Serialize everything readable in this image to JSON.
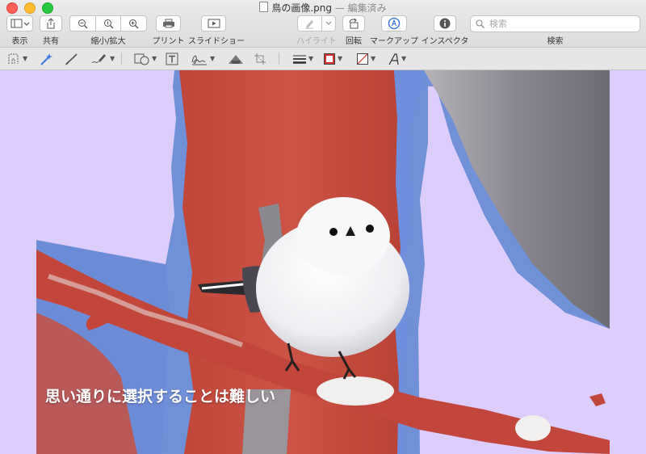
{
  "window": {
    "title": "鳥の画像.png",
    "title_separator": "—",
    "status": "編集済み"
  },
  "toolbar": {
    "view_label": "表示",
    "share_label": "共有",
    "zoom_label": "縮小/拡大",
    "print_label": "プリント",
    "slideshow_label": "スライドショー",
    "highlight_label": "ハイライト",
    "rotate_label": "回転",
    "markup_label": "マークアップ",
    "inspector_label": "インスペクタ",
    "search_label": "検索",
    "search_placeholder": "検索"
  },
  "image": {
    "caption": "思い通りに選択することは難しい"
  },
  "colors": {
    "selection_tint": "#dccdfc",
    "tree_red": "#c8493c",
    "sky_blue": "#6f8fd8",
    "close": "#fe5f57",
    "minimize": "#febc2e",
    "zoom": "#28c840"
  },
  "icons": [
    "sidebar-icon",
    "share-icon",
    "zoom-out-icon",
    "actual-size-icon",
    "zoom-in-icon",
    "print-icon",
    "slideshow-icon",
    "highlight-pen-icon",
    "rotate-icon",
    "markup-icon",
    "info-icon",
    "search-icon",
    "selection-tool-icon",
    "instant-alpha-icon",
    "sketch-icon",
    "draw-icon",
    "shapes-icon",
    "text-icon",
    "signature-icon",
    "adjust-color-icon",
    "crop-icon",
    "shape-style-icon",
    "border-color-icon",
    "fill-color-icon",
    "text-style-icon"
  ]
}
